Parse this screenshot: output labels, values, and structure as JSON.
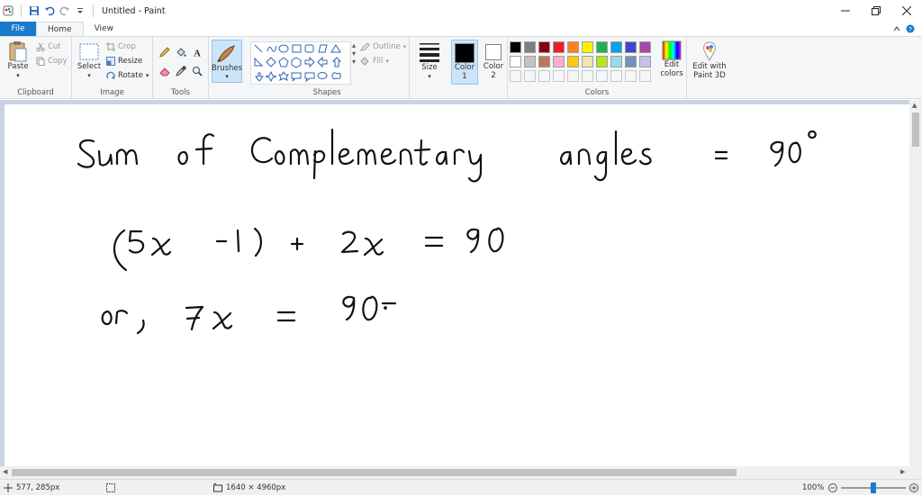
{
  "window": {
    "title": "Untitled - Paint"
  },
  "tabs": [
    {
      "label": "File"
    },
    {
      "label": "Home"
    },
    {
      "label": "View"
    }
  ],
  "ribbon": {
    "clipboard": {
      "group": "Clipboard",
      "paste": "Paste",
      "cut": "Cut",
      "copy": "Copy"
    },
    "image": {
      "group": "Image",
      "select": "Select",
      "crop": "Crop",
      "resize": "Resize",
      "rotate": "Rotate"
    },
    "tools": {
      "group": "Tools"
    },
    "brushes": {
      "label": "Brushes"
    },
    "shapes": {
      "group": "Shapes",
      "outline": "Outline",
      "fill": "Fill"
    },
    "size": {
      "label": "Size"
    },
    "color1": {
      "label1": "Color",
      "label2": "1",
      "value": "#000000"
    },
    "color2": {
      "label1": "Color",
      "label2": "2",
      "value": "#ffffff"
    },
    "colors": {
      "group": "Colors",
      "edit": "Edit colors",
      "palette_row1": [
        "#000000",
        "#7f7f7f",
        "#880015",
        "#ed1c24",
        "#ff7f27",
        "#fff200",
        "#22b14c",
        "#00a2e8",
        "#3f48cc",
        "#a349a4"
      ],
      "palette_row2": [
        "#ffffff",
        "#c3c3c3",
        "#b97a57",
        "#ffaec9",
        "#ffc90e",
        "#efe4b0",
        "#b5e61d",
        "#99d9ea",
        "#7092be",
        "#c8bfe7"
      ]
    },
    "paint3d": {
      "label": "Edit with Paint 3D"
    }
  },
  "status": {
    "cursor_pos": "577, 285px",
    "image_size": "1640 × 4960px",
    "zoom": "100%",
    "zoom_fraction": 0.5
  },
  "canvas": {
    "handwriting": [
      "Sum of complementary angles = 90°",
      "(5x - 1) + 2x = 90",
      "or, 7x = 90"
    ]
  }
}
